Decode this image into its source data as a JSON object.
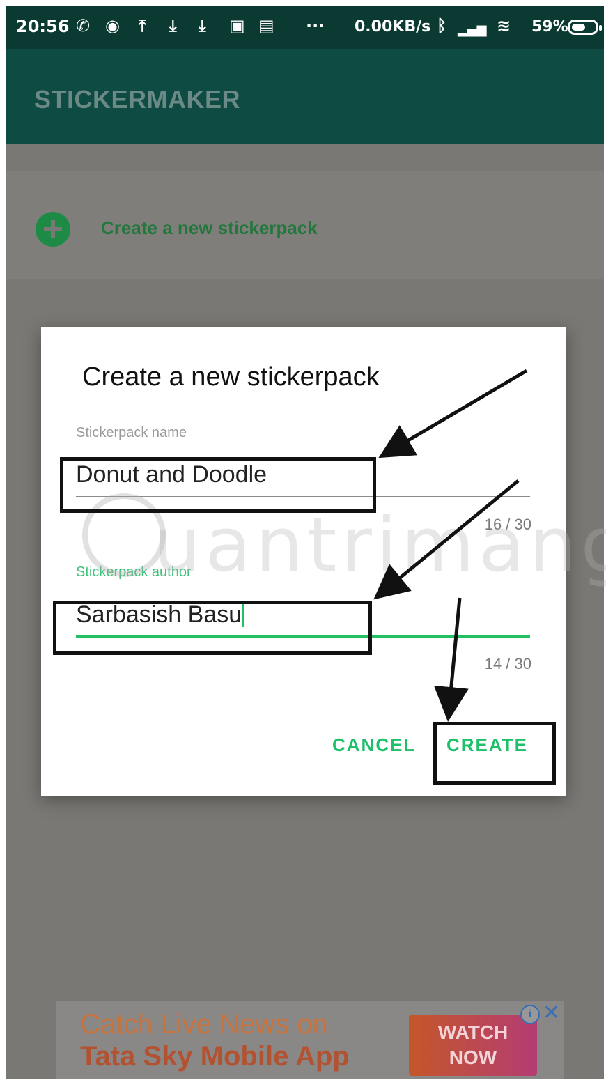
{
  "status_bar": {
    "time": "20:56",
    "network_speed": "0.00KB/s",
    "battery_percent": "59%",
    "battery_level": 0.59,
    "icons": [
      "whatsapp-icon",
      "notification-icon",
      "upload-icon",
      "download-icon",
      "download-icon",
      "gallery-icon",
      "message-icon",
      "more-dots-icon",
      "bluetooth-icon",
      "signal-icon",
      "wifi-icon",
      "battery-icon"
    ]
  },
  "toolbar": {
    "title": "STICKERMAKER"
  },
  "list": {
    "create_label": "Create a new stickerpack",
    "create_icon": "add-circle-icon"
  },
  "dialog": {
    "title": "Create a new stickerpack",
    "name_field": {
      "label": "Stickerpack name",
      "value": "Donut and Doodle",
      "counter": "16 / 30"
    },
    "author_field": {
      "label": "Stickerpack author",
      "value": "Sarbasish Basu",
      "counter": "14 / 30"
    },
    "cancel_label": "CANCEL",
    "create_label": "CREATE"
  },
  "watermark": {
    "text": "uantrimang"
  },
  "ad": {
    "line1": "Catch Live News on",
    "line2": "Tata Sky Mobile App",
    "cta_line1": "WATCH",
    "cta_line2": "NOW",
    "info_icon": "info-icon",
    "close_icon": "close-icon"
  },
  "colors": {
    "accent": "#1fc06a",
    "toolbar": "#0e4b42",
    "statusbar": "#0b3a33",
    "scrim": "#7a7874"
  }
}
